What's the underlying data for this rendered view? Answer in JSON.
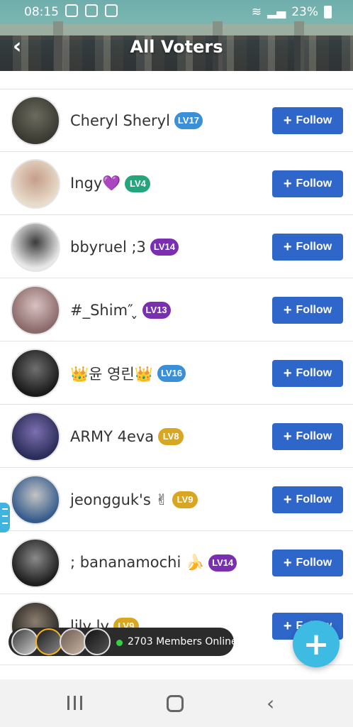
{
  "status_bar": {
    "time": "08:15",
    "battery": "23%"
  },
  "header": {
    "title": "All Voters",
    "back_icon": "back-arrow-icon"
  },
  "voters": [
    {
      "name": "Cheryl Sheryl",
      "level": "LV17",
      "level_color": "#3a8fd6",
      "follow": "Follow",
      "avatar_colors": [
        "#3a3a33",
        "#6b6b5e"
      ]
    },
    {
      "name": "Ingy💜",
      "level": "LV4",
      "level_color": "#25a57b",
      "follow": "Follow",
      "avatar_colors": [
        "#e9dccb",
        "#c59d8a"
      ]
    },
    {
      "name": "bbyruel ;3",
      "level": "LV14",
      "level_color": "#7a2fb0",
      "follow": "Follow",
      "avatar_colors": [
        "#e8e8e8",
        "#3b3b3b"
      ]
    },
    {
      "name": "#_Shim″ ̬",
      "level": "LV13",
      "level_color": "#7a2fb0",
      "follow": "Follow",
      "avatar_colors": [
        "#8b6a6a",
        "#d9c2c2"
      ]
    },
    {
      "name": "👑윤 영린👑",
      "level": "LV16",
      "level_color": "#3a8fd6",
      "follow": "Follow",
      "avatar_colors": [
        "#1a1a1a",
        "#6f6f6f"
      ]
    },
    {
      "name": "ARMY 4eva",
      "level": "LV8",
      "level_color": "#d9a621",
      "follow": "Follow",
      "avatar_colors": [
        "#2b2d59",
        "#7b6fb0"
      ]
    },
    {
      "name": "jeongguk's ✌",
      "level": "LV9",
      "level_color": "#d9a621",
      "follow": "Follow",
      "avatar_colors": [
        "#365c8c",
        "#c4c4c4"
      ]
    },
    {
      "name": "; bananamochi 🍌",
      "level": "LV14",
      "level_color": "#7a2fb0",
      "follow": "Follow",
      "avatar_colors": [
        "#1e1e1e",
        "#8a8a8a"
      ]
    },
    {
      "name": "lily ly",
      "level": "LV9",
      "level_color": "#d9a621",
      "follow": "Follow",
      "avatar_colors": [
        "#2e2a26",
        "#8b7e70"
      ]
    }
  ],
  "online": {
    "text": "2703 Members Online"
  },
  "colors": {
    "follow_button": "#2f66c9",
    "fab": "#3dbbe3",
    "online_dot": "#35d043"
  }
}
